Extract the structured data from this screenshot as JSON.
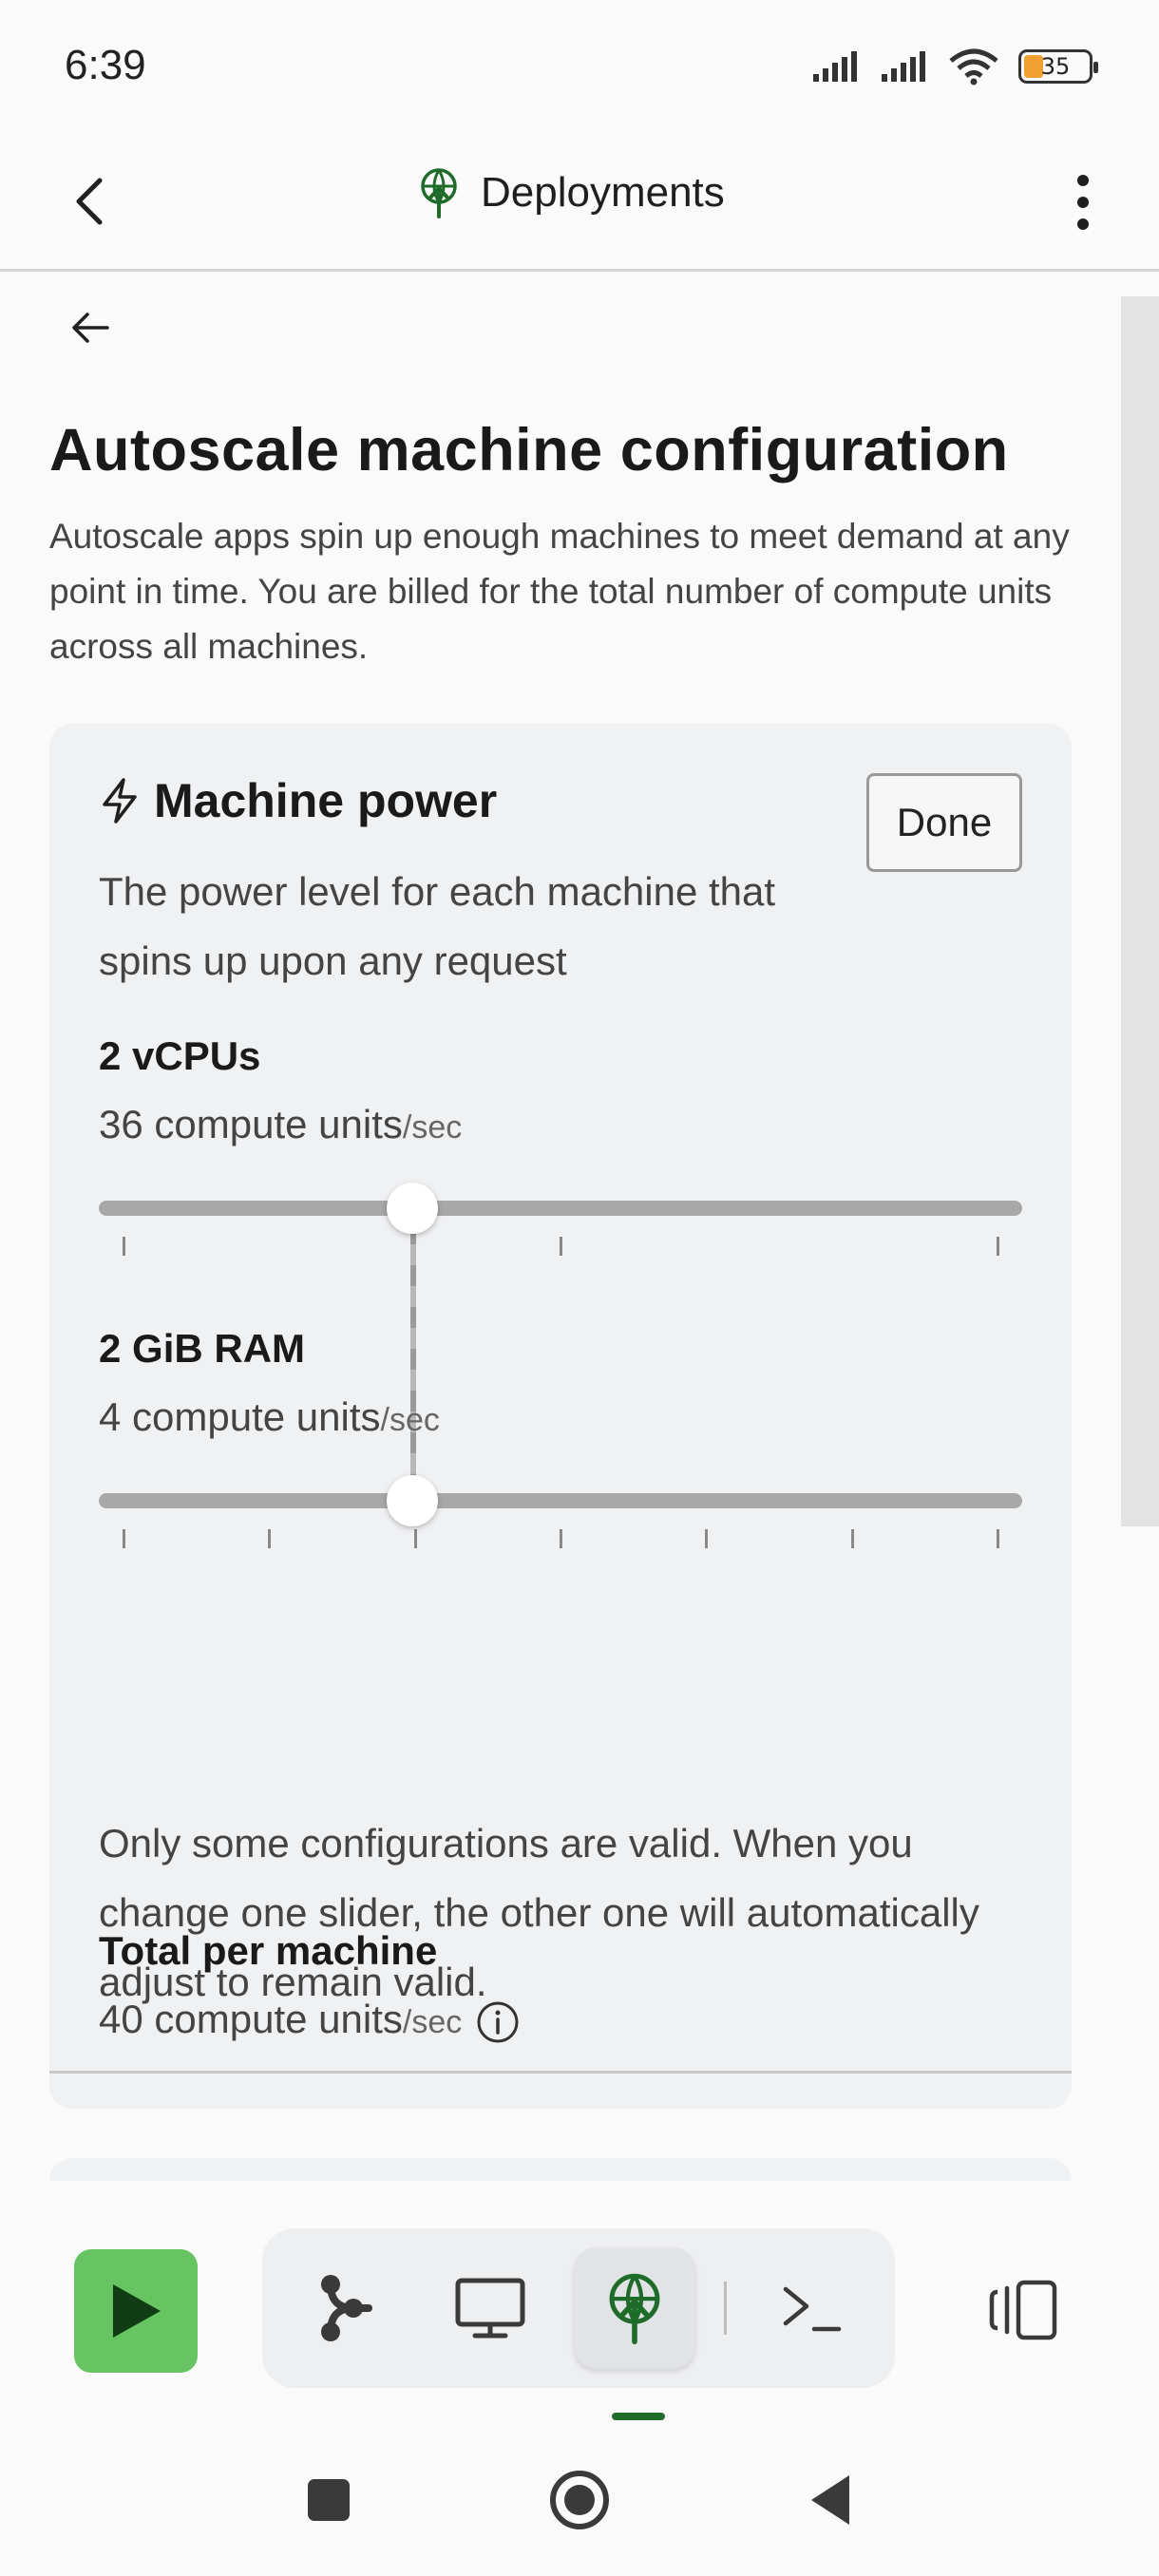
{
  "status": {
    "time": "6:39",
    "battery": "35"
  },
  "header": {
    "title": "Deployments"
  },
  "page": {
    "title": "Autoscale machine configuration",
    "description": "Autoscale apps spin up enough machines to meet demand at any point in time. You are billed for the total number of compute units across all machines."
  },
  "machine_power": {
    "title": "Machine power",
    "done_label": "Done",
    "description": "The power level for each machine that spins up upon any request",
    "cpu": {
      "label": "2 vCPUs",
      "value": "36 compute units",
      "unit": "/sec",
      "slider_fraction": 0.34,
      "tick_count": 3
    },
    "ram": {
      "label": "2 GiB RAM",
      "value": "4 compute units",
      "unit": "/sec",
      "slider_fraction": 0.34,
      "tick_count": 7
    },
    "note": "Only some configurations are valid. When you change one slider, the other one will automatically adjust to remain valid."
  },
  "total": {
    "label": "Total per machine",
    "value": "40 compute units",
    "unit": "/sec"
  },
  "colors": {
    "accent_green": "#66c462",
    "icon_green": "#1f6b2a"
  },
  "toolbar": {
    "icons": [
      "run-icon",
      "git-icon",
      "webview-icon",
      "deployments-icon",
      "shell-icon",
      "panes-icon"
    ]
  }
}
